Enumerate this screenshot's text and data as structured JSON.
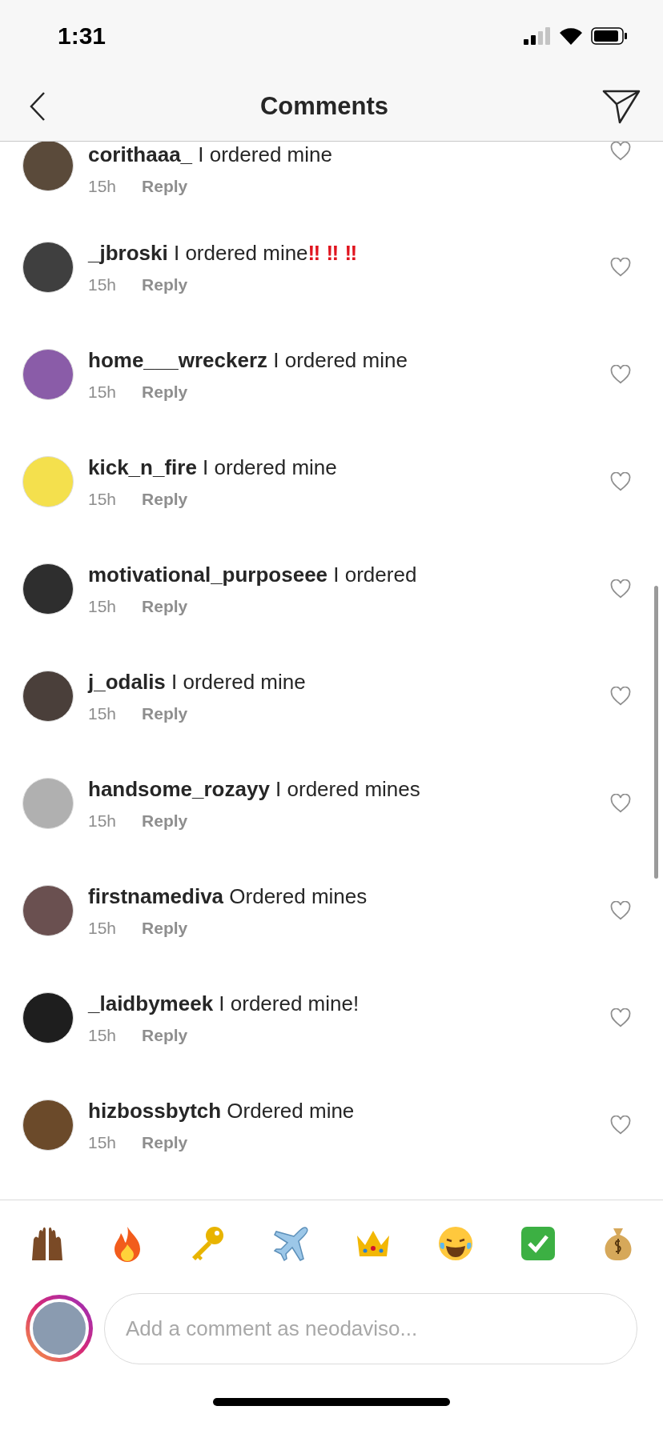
{
  "status_bar": {
    "time": "1:31"
  },
  "header": {
    "title": "Comments"
  },
  "comments": [
    {
      "text": "**corithaaa_** I ordered mine",
      "time": "15h",
      "reply": "Reply",
      "liked": false
    },
    {
      "text": "**_jbroski** I ordered mine",
      "extra": "‼ ‼ ‼",
      "time": "15h",
      "reply": "Reply",
      "liked": false
    },
    {
      "text": "**home___wreckerz** I ordered mine",
      "time": "15h",
      "reply": "Reply",
      "liked": false
    },
    {
      "text": "**kick_n_fire** I ordered mine",
      "time": "15h",
      "reply": "Reply",
      "liked": false
    },
    {
      "text": "**motivational_purposeee** I ordered",
      "time": "15h",
      "reply": "Reply",
      "liked": false
    },
    {
      "text": "**j_odalis** I ordered mine",
      "time": "15h",
      "reply": "Reply",
      "liked": false
    },
    {
      "text": "**handsome_rozayy** I ordered mines",
      "time": "15h",
      "reply": "Reply",
      "liked": false
    },
    {
      "text": "**firstnamediva** Ordered mines",
      "time": "15h",
      "reply": "Reply",
      "liked": false
    },
    {
      "text": "**_laidbymeek** I ordered mine!",
      "time": "15h",
      "reply": "Reply",
      "liked": false
    },
    {
      "text": "**hizbossbytch** Ordered mine",
      "time": "15h",
      "reply": "Reply",
      "liked": false
    }
  ],
  "composer": {
    "placeholder": "Add a comment as neodaviso..."
  }
}
